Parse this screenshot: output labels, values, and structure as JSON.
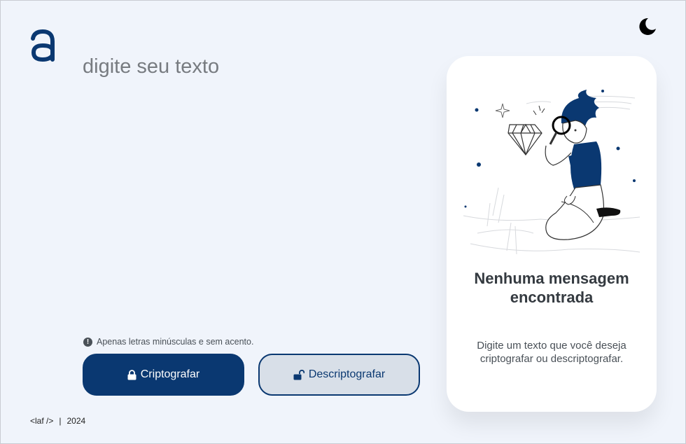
{
  "app": {
    "logo_letter": "a"
  },
  "theme": {
    "icon": "moon-icon"
  },
  "editor": {
    "placeholder": "digite seu texto",
    "value": ""
  },
  "hint": {
    "icon": "info-icon",
    "text": "Apenas letras minúsculas e sem acento."
  },
  "buttons": {
    "encrypt_label": "Criptografar",
    "decrypt_label": "Descriptografar"
  },
  "output": {
    "title": "Nenhuma mensagem encontrada",
    "text": "Digite um texto que você deseja criptografar ou descriptografar."
  },
  "footer": {
    "brand": "<laf />",
    "separator": "|",
    "year": "2024"
  },
  "colors": {
    "primary": "#0a3871",
    "background": "#f0f4fb",
    "card": "#ffffff",
    "secondary_button": "#d8dfe8"
  }
}
